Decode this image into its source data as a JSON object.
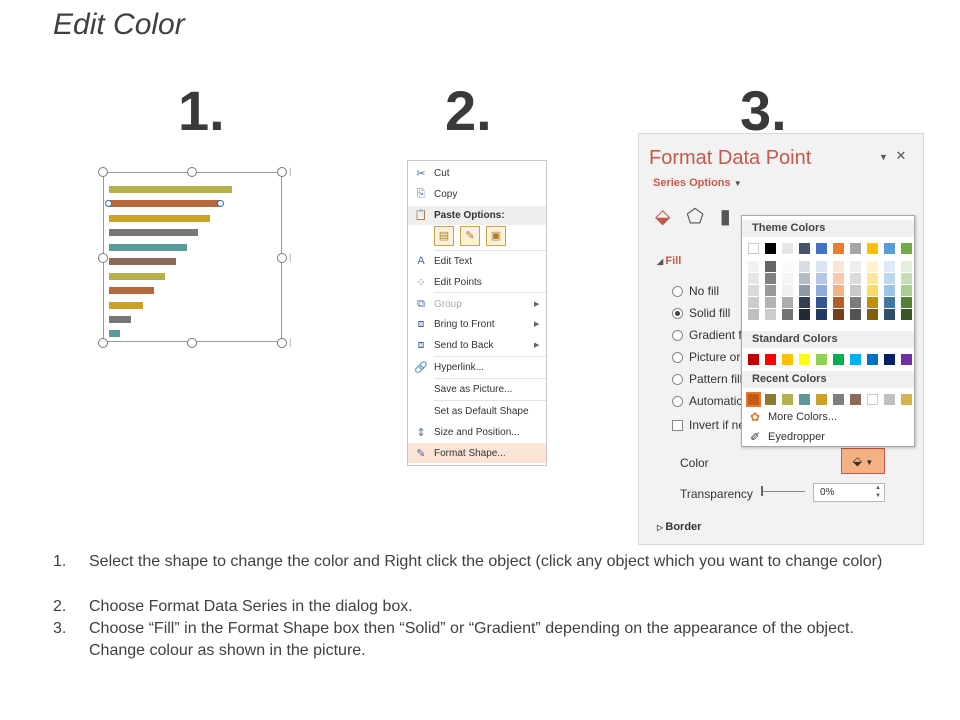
{
  "title": "Edit Color",
  "steps": [
    "1.",
    "2.",
    "3."
  ],
  "context_menu": {
    "items": [
      {
        "label": "Cut",
        "icon": "scissors-icon",
        "glyph": "✂"
      },
      {
        "label": "Copy",
        "icon": "copy-icon",
        "glyph": "⎘"
      },
      {
        "label": "Paste Options:",
        "icon": "paste-icon",
        "glyph": "📋"
      },
      {
        "label": "Edit Text",
        "icon": "edit-text-icon",
        "glyph": "A"
      },
      {
        "label": "Edit Points",
        "icon": "edit-points-icon",
        "glyph": "⁘"
      },
      {
        "label": "Group",
        "icon": "group-icon",
        "glyph": "⧉"
      },
      {
        "label": "Bring to Front",
        "icon": "bring-to-front-icon",
        "glyph": "⧈"
      },
      {
        "label": "Send to Back",
        "icon": "send-to-back-icon",
        "glyph": "⧈"
      },
      {
        "label": "Hyperlink...",
        "icon": "hyperlink-icon",
        "glyph": "🔗"
      },
      {
        "label": "Save as Picture...",
        "icon": "",
        "glyph": ""
      },
      {
        "label": "Set as Default Shape",
        "icon": "",
        "glyph": ""
      },
      {
        "label": "Size and Position...",
        "icon": "size-position-icon",
        "glyph": "⇕"
      },
      {
        "label": "Format Shape...",
        "icon": "format-shape-icon",
        "glyph": "✎"
      }
    ]
  },
  "format_pane": {
    "title": "Format Data Point",
    "series_options": "Series Options",
    "fill_label": "Fill",
    "options": [
      "No fill",
      "Solid fill",
      "Gradient fi",
      "Picture or",
      "Pattern fill",
      "Automatic"
    ],
    "invert_label": "Invert if ne",
    "color_label": "Color",
    "transparency_label": "Transparency",
    "transparency_value": "0%",
    "border_label": "Border"
  },
  "color_dropdown": {
    "theme_colors_label": "Theme Colors",
    "standard_colors_label": "Standard Colors",
    "recent_colors_label": "Recent Colors",
    "more_colors": "More Colors...",
    "eyedropper": "Eyedropper",
    "theme_top": [
      "#ffffff",
      "#000000",
      "#e7e6e6",
      "#44546a",
      "#4472c4",
      "#ed7d31",
      "#a5a5a5",
      "#ffc000",
      "#5b9bd5",
      "#70ad47"
    ],
    "standard": [
      "#c00000",
      "#ff0000",
      "#ffc000",
      "#ffff00",
      "#92d050",
      "#00b050",
      "#00b0f0",
      "#0070c0",
      "#002060",
      "#7030a0"
    ],
    "recent": [
      "#c55a11",
      "#8b7a2f",
      "#b5b04a",
      "#5a9a9a",
      "#c9a227",
      "#7f7f7f",
      "#8b6a5a",
      "#ffffff",
      "#bfbfbf",
      "#d4b44a"
    ]
  },
  "instructions": [
    {
      "num": "1.",
      "text": "Select the shape to change the color and Right click the object (click any object which you want to change color)"
    },
    {
      "num": "2.",
      "text": "Choose Format Data Series in the dialog box."
    },
    {
      "num": "3.",
      "text": "Choose “Fill” in the Format Shape box then “Solid” or “Gradient” depending on the appearance of the object. Change colour as shown in the picture."
    }
  ]
}
